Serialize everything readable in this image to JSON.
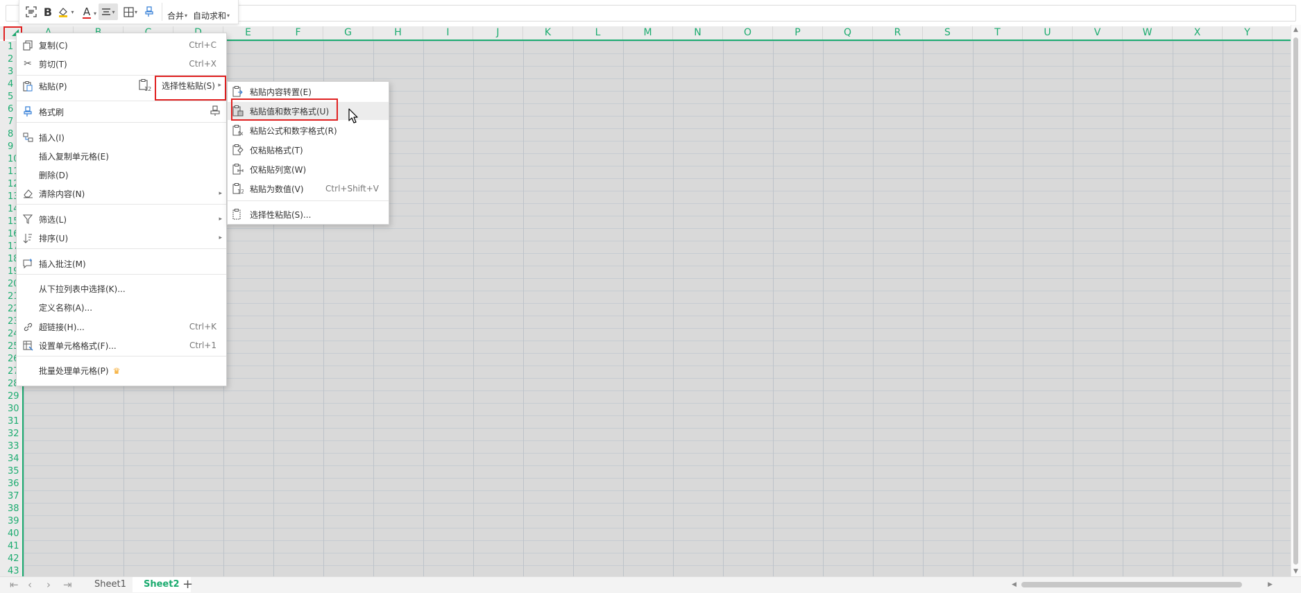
{
  "toolbar": {
    "merge_label": "合并",
    "autosum_label": "自动求和",
    "bold_label": "B",
    "font_color_label": "A",
    "accent_color": "#1bab6f",
    "font_color_underline": "#e02020"
  },
  "columns": [
    "A",
    "B",
    "C",
    "D",
    "E",
    "F",
    "G",
    "H",
    "I",
    "J",
    "K",
    "L",
    "M",
    "N",
    "O",
    "P",
    "Q",
    "R",
    "S",
    "T",
    "U",
    "V",
    "W",
    "X",
    "Y"
  ],
  "rows": [
    "1",
    "2",
    "3",
    "4",
    "5",
    "6",
    "7",
    "8",
    "9",
    "10",
    "11",
    "12",
    "13",
    "14",
    "15",
    "16",
    "17",
    "18",
    "19",
    "20",
    "21",
    "22",
    "23",
    "24",
    "25",
    "26",
    "27",
    "28",
    "29",
    "30",
    "31",
    "32",
    "33",
    "34",
    "35",
    "36",
    "37",
    "38",
    "39",
    "40",
    "41",
    "42",
    "43"
  ],
  "context_menu": {
    "copy": {
      "label": "复制(C)",
      "shortcut": "Ctrl+C",
      "icon": "copy-icon"
    },
    "cut": {
      "label": "剪切(T)",
      "shortcut": "Ctrl+X",
      "icon": "scissors-icon"
    },
    "paste": {
      "label": "粘贴(P)",
      "icon": "paste-icon"
    },
    "paste_special": {
      "label": "选择性粘贴(S)"
    },
    "format_painter": {
      "label": "格式刷",
      "icon": "format-painter-icon"
    },
    "insert": {
      "label": "插入(I)",
      "icon": "insert-icon"
    },
    "insert_copied": {
      "label": "插入复制单元格(E)"
    },
    "delete": {
      "label": "删除(D)"
    },
    "clear": {
      "label": "清除内容(N)",
      "icon": "eraser-icon"
    },
    "filter": {
      "label": "筛选(L)",
      "icon": "filter-icon"
    },
    "sort": {
      "label": "排序(U)",
      "icon": "sort-icon"
    },
    "insert_comment": {
      "label": "插入批注(M)",
      "icon": "comment-icon"
    },
    "pick_from_list": {
      "label": "从下拉列表中选择(K)..."
    },
    "define_name": {
      "label": "定义名称(A)..."
    },
    "hyperlink": {
      "label": "超链接(H)...",
      "shortcut": "Ctrl+K",
      "icon": "link-icon"
    },
    "format_cells": {
      "label": "设置单元格格式(F)...",
      "shortcut": "Ctrl+1",
      "icon": "format-cells-icon"
    },
    "batch": {
      "label": "批量处理单元格(P)",
      "icon": "crown-icon"
    }
  },
  "submenu": {
    "transpose": {
      "label": "粘贴内容转置(E)"
    },
    "values_number_formats": {
      "label": "粘贴值和数字格式(U)"
    },
    "formulas_number_formats": {
      "label": "粘贴公式和数字格式(R)"
    },
    "formats_only": {
      "label": "仅粘贴格式(T)"
    },
    "column_widths_only": {
      "label": "仅粘贴列宽(W)"
    },
    "paste_as_values": {
      "label": "粘贴为数值(V)",
      "shortcut": "Ctrl+Shift+V"
    },
    "paste_special_dialog": {
      "label": "选择性粘贴(S)..."
    }
  },
  "sheets": {
    "tab1": "Sheet1",
    "tab2": "Sheet2",
    "active": "Sheet2"
  }
}
